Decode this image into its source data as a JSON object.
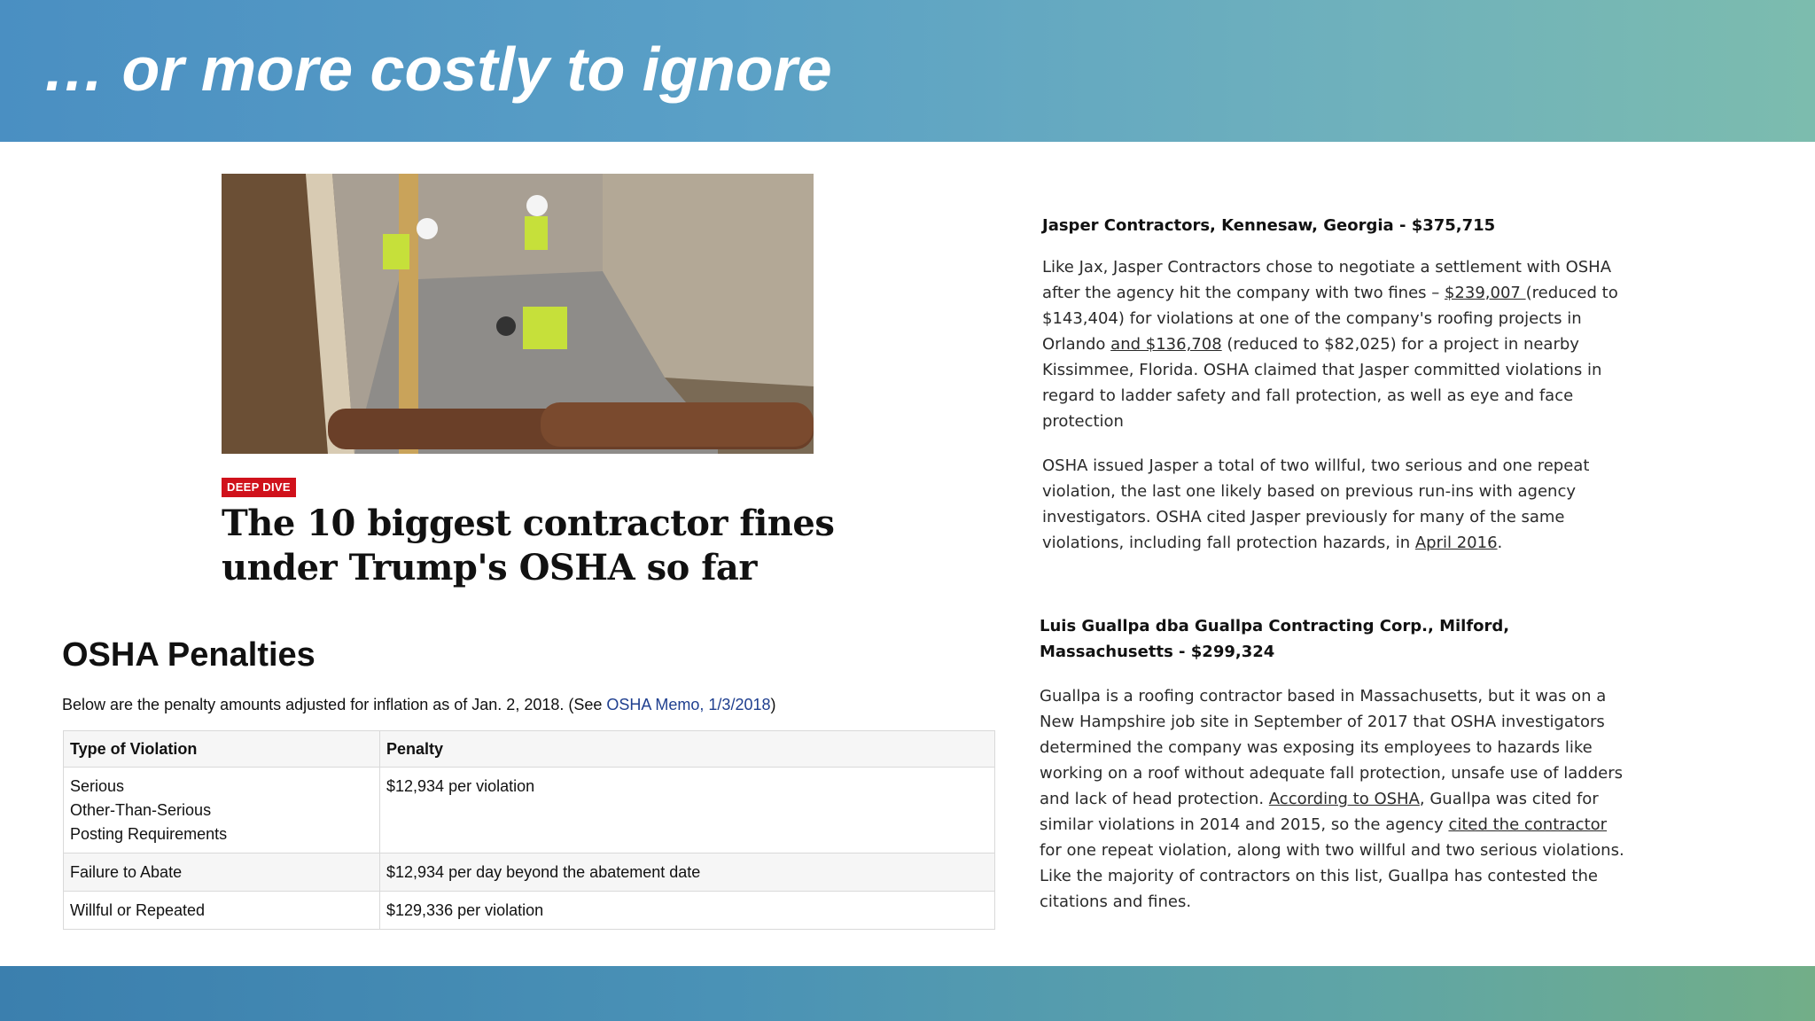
{
  "slide": {
    "title": "… or more costly to ignore"
  },
  "article": {
    "badge": "DEEP DIVE",
    "headline": "The 10 biggest contractor fines under Trump's OSHA so far",
    "image_alt": "Workers in hard hats and safety vests working in a trench excavation"
  },
  "osha": {
    "title": "OSHA Penalties",
    "intro_prefix": "Below are the penalty amounts adjusted for inflation as of Jan. 2, 2018. (See ",
    "intro_link": "OSHA Memo, 1/3/2018",
    "intro_suffix": ")",
    "table": {
      "headers": [
        "Type of Violation",
        "Penalty"
      ],
      "rows": [
        {
          "type_lines": [
            "Serious",
            "Other-Than-Serious",
            "Posting Requirements"
          ],
          "penalty": "$12,934 per violation"
        },
        {
          "type_lines": [
            "Failure to Abate"
          ],
          "penalty": "$12,934 per day beyond the abatement date"
        },
        {
          "type_lines": [
            "Willful or Repeated"
          ],
          "penalty": "$129,336 per violation"
        }
      ]
    }
  },
  "cases": [
    {
      "title": "Jasper Contractors, Kennesaw, Georgia - $375,715",
      "paragraphs": [
        [
          {
            "text": "Like Jax, Jasper Contractors chose to negotiate a settlement with OSHA after the agency hit the company with two fines –  "
          },
          {
            "text": "$239,007 ",
            "link": true
          },
          {
            "text": " (reduced to $143,404) for violations at one of the company's roofing projects in Orlando "
          },
          {
            "text": "and $136,708",
            "link": true
          },
          {
            "text": " (reduced to $82,025) for a project in nearby Kissimmee, Florida. OSHA claimed that Jasper committed violations in regard to ladder safety and fall protection, as well as eye and face protection"
          }
        ],
        [
          {
            "text": "OSHA issued Jasper a total of two willful, two serious and one repeat violation, the last one likely based on previous run-ins with agency investigators. OSHA cited Jasper previously for many of the same violations, including fall protection hazards, in "
          },
          {
            "text": "April 2016",
            "link": true
          },
          {
            "text": "."
          }
        ]
      ]
    },
    {
      "title": "Luis Guallpa dba Guallpa Contracting Corp., Milford, Massachusetts - $299,324",
      "paragraphs": [
        [
          {
            "text": "Guallpa is a roofing contractor based in Massachusetts, but it was on a New Hampshire job site in September of 2017 that OSHA investigators determined the company was exposing its employees to hazards like working on a roof without adequate fall protection, unsafe use of ladders and lack of head protection. "
          },
          {
            "text": "According to OSHA",
            "link": true
          },
          {
            "text": ", Guallpa was cited for similar violations in 2014 and 2015, so the agency "
          },
          {
            "text": "cited the contractor",
            "link": true
          },
          {
            "text": " for one repeat violation, along with two willful and two serious violations. Like the majority of contractors on this list, Guallpa has contested the citations and fines."
          }
        ]
      ]
    }
  ]
}
